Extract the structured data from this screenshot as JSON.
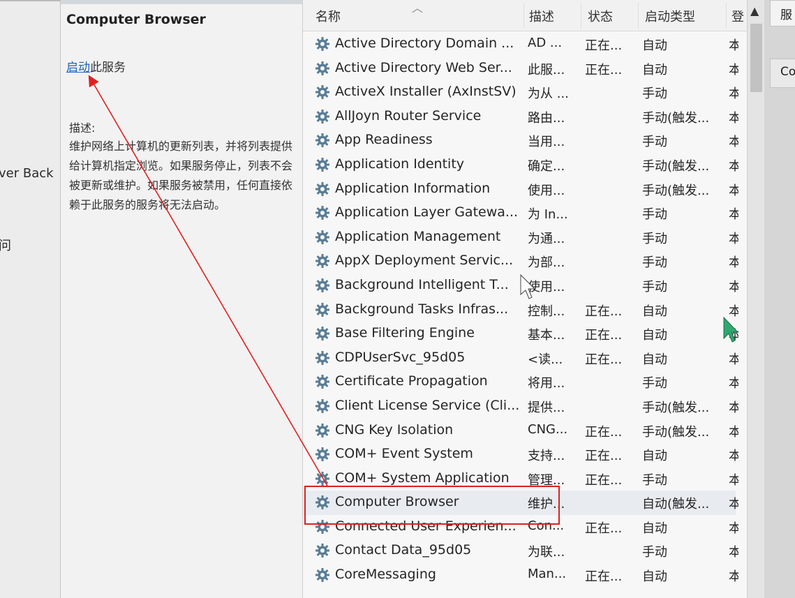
{
  "left_clipped": {
    "text1": "ver Back",
    "text2": "问"
  },
  "details": {
    "title": "Computer Browser",
    "start_link": "启动",
    "start_suffix": "此服务",
    "desc_label": "描述:",
    "desc_text": "维护网络上计算机的更新列表，并将列表提供给计算机指定浏览。如果服务停止，列表不会被更新或维护。如果服务被禁用，任何直接依赖于此服务的服务将无法启动。"
  },
  "list": {
    "headers": {
      "name": "名称",
      "desc": "描述",
      "status": "状态",
      "start_type": "启动类型",
      "logon": "登"
    },
    "rows": [
      {
        "name": "Active Directory Domain ...",
        "desc": "AD ...",
        "status": "正在...",
        "start": "自动",
        "logon": "本"
      },
      {
        "name": "Active Directory Web Ser...",
        "desc": "此服...",
        "status": "正在...",
        "start": "自动",
        "logon": "本"
      },
      {
        "name": "ActiveX Installer (AxInstSV)",
        "desc": "为从 ...",
        "status": "",
        "start": "手动",
        "logon": "本"
      },
      {
        "name": "AllJoyn Router Service",
        "desc": "路由...",
        "status": "",
        "start": "手动(触发...",
        "logon": "本"
      },
      {
        "name": "App Readiness",
        "desc": "当用...",
        "status": "",
        "start": "手动",
        "logon": "本"
      },
      {
        "name": "Application Identity",
        "desc": "确定...",
        "status": "",
        "start": "手动(触发...",
        "logon": "本"
      },
      {
        "name": "Application Information",
        "desc": "使用...",
        "status": "",
        "start": "手动(触发...",
        "logon": "本"
      },
      {
        "name": "Application Layer Gatewa...",
        "desc": "为 In...",
        "status": "",
        "start": "手动",
        "logon": "本"
      },
      {
        "name": "Application Management",
        "desc": "为通...",
        "status": "",
        "start": "手动",
        "logon": "本"
      },
      {
        "name": "AppX Deployment Servic...",
        "desc": "为部...",
        "status": "",
        "start": "手动",
        "logon": "本"
      },
      {
        "name": "Background Intelligent T...",
        "desc": "使用...",
        "status": "",
        "start": "手动",
        "logon": "本"
      },
      {
        "name": "Background Tasks Infras...",
        "desc": "控制...",
        "status": "正在...",
        "start": "自动",
        "logon": "本"
      },
      {
        "name": "Base Filtering Engine",
        "desc": "基本...",
        "status": "正在...",
        "start": "自动",
        "logon": "本"
      },
      {
        "name": "CDPUserSvc_95d05",
        "desc": "<读...",
        "status": "正在...",
        "start": "自动",
        "logon": "本"
      },
      {
        "name": "Certificate Propagation",
        "desc": "将用...",
        "status": "",
        "start": "手动",
        "logon": "本"
      },
      {
        "name": "Client License Service (Cli...",
        "desc": "提供...",
        "status": "",
        "start": "手动(触发...",
        "logon": "本"
      },
      {
        "name": "CNG Key Isolation",
        "desc": "CNG...",
        "status": "正在...",
        "start": "手动(触发...",
        "logon": "本"
      },
      {
        "name": "COM+ Event System",
        "desc": "支持...",
        "status": "正在...",
        "start": "自动",
        "logon": "本"
      },
      {
        "name": "COM+ System Application",
        "desc": "管理...",
        "status": "正在...",
        "start": "手动",
        "logon": "本"
      },
      {
        "name": "Computer Browser",
        "desc": "维护...",
        "status": "",
        "start": "自动(触发...",
        "logon": "本"
      },
      {
        "name": "Connected User Experien...",
        "desc": "Con...",
        "status": "正在...",
        "start": "自动",
        "logon": "本"
      },
      {
        "name": "Contact Data_95d05",
        "desc": "为联...",
        "status": "",
        "start": "手动",
        "logon": "本"
      },
      {
        "name": "CoreMessaging",
        "desc": "Man...",
        "status": "正在...",
        "start": "自动",
        "logon": "本"
      }
    ]
  },
  "right_strip": {
    "tab1": "服",
    "tab2": "Co"
  },
  "colors": {
    "annotation": "#e02020",
    "link": "#1f62b5",
    "gear_icon": "#5a7d96"
  },
  "icons": {
    "service": "gear-icon",
    "scroll_up": "chevron-up-icon",
    "sort": "chevron-up-icon"
  }
}
